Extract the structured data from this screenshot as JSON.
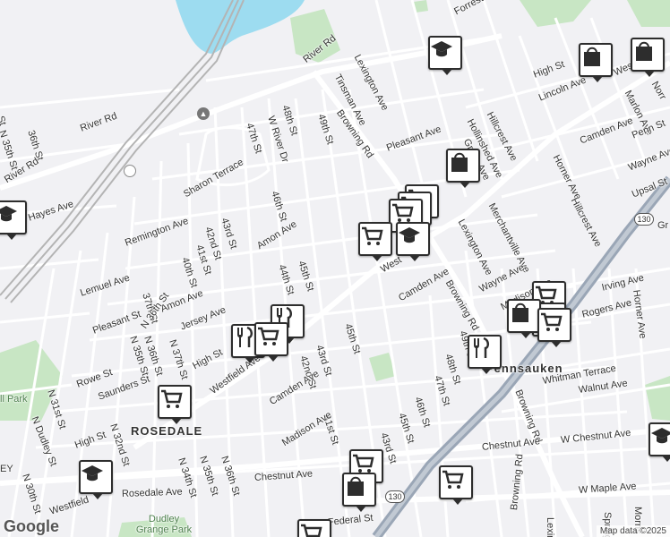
{
  "map": {
    "attribution": "Map data ©2025",
    "logo": "Google",
    "places": {
      "pennsauken": "Pennsauken",
      "rosedale": "ROSEDALE",
      "dudley_park": "Dudley Grange Park",
      "hill_park": "ll Park"
    },
    "highway_shield": "130",
    "streets": {
      "river_rd_top": "River Rd",
      "river_rd_left": "River Rd",
      "river_rd_top_left": "River Rd",
      "forrest_ave": "Forrest Ave",
      "lexington_ave_top": "Lexington Ave",
      "tinsman_ave": "Tinsman Ave",
      "s48th_top": "48th St",
      "s49th_top": "49th St",
      "w_river_dr": "W River Dr",
      "s47th_top": "47th St",
      "browning_rd_top": "Browning Rd",
      "high_st_top": "High St",
      "lincoln_ave": "Lincoln Ave",
      "west_top": "West",
      "marlon_ave": "Marlon Ave",
      "hillcrest_ave_top": "Hillcrest Ave",
      "hollinshed_ave": "Hollinshed Ave",
      "pleasant_ave": "Pleasant Ave",
      "gross_ave": "Gross Ave",
      "camden_ave_top": "Camden Ave",
      "penn_st": "Penn St",
      "horner_ave_top": "Horner Ave",
      "wayne_ave_top": "Wayne Ave",
      "upsal_st": "Upsal St",
      "hillcrest_ave_mid": "Hillcrest Ave",
      "merchantville_ave": "Merchantville Ave",
      "lexington_ave_mid": "Lexington Ave",
      "n35th_top": "N 35th St",
      "n36th_top": "36th St",
      "river_rd_mid": "River Rd",
      "hayes_ave": "Hayes Ave",
      "sharon_terrace": "Sharon Terrace",
      "remington_ave": "Remington Ave",
      "s46th_mid": "46th St",
      "s43rd_mid": "43rd St",
      "s42nd_mid": "42nd St",
      "s41st_mid": "41st St",
      "s40th_mid": "40th St",
      "amon_ave_mid": "Amon Ave",
      "s44th_mid": "44th St",
      "s45th_mid": "45th St",
      "n36th_left": "N 36th St",
      "lemuel_ave": "Lemuel Ave",
      "s37th": "37th St",
      "amon_ave_low": "Amon Ave",
      "jersey_ave": "Jersey Ave",
      "pleasant_st": "Pleasant St",
      "n35th_mid": "N 35th St",
      "n36th_mid": "N 36th St",
      "n37th": "N 37th St",
      "high_st_mid": "High St",
      "westfield_ave": "Westfield Ave",
      "west_mid": "West",
      "camden_ave_mid": "Camden Ave",
      "wayne_ave_mid": "Wayne Ave",
      "madison_ave_top": "Madison Ave",
      "irving_ave": "Irving Ave",
      "horner_ave_right": "Horner Ave",
      "rogers_ave": "Rogers Ave",
      "browning_rd_mid": "Browning Rd",
      "s49th_mid": "49th St",
      "s48th_mid": "48th St",
      "s45th_low": "45th St",
      "s43rd_low": "43rd St",
      "s42nd_low": "42nd St",
      "camden_ave_low": "Camden Ave",
      "whitman_terrace": "Whitman Terrace",
      "walnut_ave": "Walnut Ave",
      "browning_rd_low": "Browning Rd",
      "s47th_low": "47th St",
      "s46th_low": "46th St",
      "s45th_bottom": "45th St",
      "s43rd_bottom": "43rd St",
      "s41st_low": "41st St",
      "madison_ave_low": "Madison Ave",
      "rowe_st": "Rowe St",
      "saunders_st": "Saunders St",
      "n31st": "N 31st St",
      "n_dudley": "N Dudley St",
      "high_st_low": "High St",
      "n32nd": "N 32nd St",
      "n34th": "N 34th St",
      "n35th_low": "N 35th St",
      "n36th_low": "N 36th St",
      "chestnut_ave_left": "Chestnut Ave",
      "chestnut_ave_right": "Chestnut Ave",
      "w_chestnut_ave": "W Chestnut Ave",
      "w_maple_ave": "W Maple Ave",
      "rosedale_ave": "Rosedale Ave",
      "n30th": "N 30th St",
      "westfield_low": "Westfield",
      "federal_st": "Federal St",
      "morris": "Morris",
      "spring": "Spring",
      "lexin": "Lexin",
      "browning_bottom": "Browning Rd",
      "norr": "Norr",
      "ey": "EY",
      "gr": "Gr",
      "st_top_left": "St"
    },
    "pins": [
      {
        "kind": "school",
        "label": "school"
      },
      {
        "kind": "shopping",
        "label": "shopping"
      },
      {
        "kind": "shopping",
        "label": "shopping"
      },
      {
        "kind": "shopping",
        "label": "shopping"
      },
      {
        "kind": "grocery",
        "label": "grocery"
      },
      {
        "kind": "grocery",
        "label": "grocery"
      },
      {
        "kind": "grocery",
        "label": "grocery"
      },
      {
        "kind": "grocery",
        "label": "grocery"
      },
      {
        "kind": "school",
        "label": "school"
      },
      {
        "kind": "restaurant",
        "label": "restaurant"
      },
      {
        "kind": "restaurant",
        "label": "restaurant"
      },
      {
        "kind": "grocery",
        "label": "grocery"
      },
      {
        "kind": "grocery",
        "label": "grocery"
      },
      {
        "kind": "grocery",
        "label": "grocery"
      },
      {
        "kind": "shopping",
        "label": "shopping"
      },
      {
        "kind": "grocery",
        "label": "grocery"
      },
      {
        "kind": "restaurant",
        "label": "restaurant"
      },
      {
        "kind": "grocery",
        "label": "grocery"
      },
      {
        "kind": "school",
        "label": "school"
      },
      {
        "kind": "grocery",
        "label": "grocery"
      },
      {
        "kind": "shopping",
        "label": "shopping"
      },
      {
        "kind": "grocery",
        "label": "grocery"
      },
      {
        "kind": "grocery",
        "label": "grocery"
      },
      {
        "kind": "school",
        "label": "school"
      },
      {
        "kind": "school",
        "label": "school"
      }
    ],
    "colors": {
      "background": "#f1f1f4",
      "water": "#9ddcf0",
      "park": "#c8e6c4",
      "road": "#ffffff",
      "highway": "#9aa6b6",
      "rail": "#b4b4b4",
      "pin_border": "#2d2d2d"
    }
  }
}
